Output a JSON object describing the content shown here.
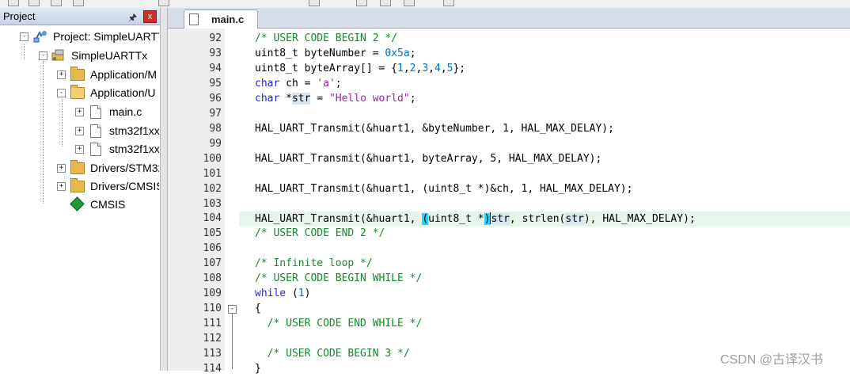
{
  "project_panel": {
    "title": "Project",
    "pin_glyph": "➕",
    "close_glyph": "x",
    "tree": [
      {
        "label": "Project: SimpleUARTT",
        "icon": "project-icon",
        "expander": "-"
      },
      {
        "label": "SimpleUARTTx",
        "icon": "target-icon",
        "expander": "-"
      },
      {
        "label": "Application/M",
        "icon": "folder-icon",
        "expander": "+"
      },
      {
        "label": "Application/U",
        "icon": "folder-open-icon",
        "expander": "-"
      },
      {
        "label": "main.c",
        "icon": "file-icon",
        "expander": "+"
      },
      {
        "label": "stm32f1xx",
        "icon": "file-icon",
        "expander": "+"
      },
      {
        "label": "stm32f1xx",
        "icon": "file-icon",
        "expander": "+"
      },
      {
        "label": "Drivers/STM32",
        "icon": "folder-icon",
        "expander": "+"
      },
      {
        "label": "Drivers/CMSIS",
        "icon": "folder-icon",
        "expander": "+"
      },
      {
        "label": "CMSIS",
        "icon": "cmsis-diamond-icon",
        "expander": ""
      }
    ]
  },
  "editor": {
    "tab_label": "main.c",
    "lines": [
      {
        "n": "92"
      },
      {
        "n": "93"
      },
      {
        "n": "94"
      },
      {
        "n": "95"
      },
      {
        "n": "96"
      },
      {
        "n": "97"
      },
      {
        "n": "98"
      },
      {
        "n": "99"
      },
      {
        "n": "100"
      },
      {
        "n": "101"
      },
      {
        "n": "102"
      },
      {
        "n": "103"
      },
      {
        "n": "104"
      },
      {
        "n": "105"
      },
      {
        "n": "106"
      },
      {
        "n": "107"
      },
      {
        "n": "108"
      },
      {
        "n": "109"
      },
      {
        "n": "110"
      },
      {
        "n": "111"
      },
      {
        "n": "112"
      },
      {
        "n": "113"
      },
      {
        "n": "114"
      }
    ],
    "code": {
      "l92": "/* USER CODE BEGIN 2 */",
      "l93a": "uint8_t byteNumber = ",
      "l93b": "0x5a",
      "l93c": ";",
      "l94a": "uint8_t byteArray[] = {",
      "l94b": "1",
      "l94c": ",",
      "l94d": "2",
      "l94e": ",",
      "l94f": "3",
      "l94g": ",",
      "l94h": "4",
      "l94i": ",",
      "l94j": "5",
      "l94k": "};",
      "l95a": "char",
      "l95b": " ch = ",
      "l95c": "'a'",
      "l95d": ";",
      "l96a": "char",
      "l96b": " *",
      "l96c": "str",
      "l96d": " = ",
      "l96e": "\"Hello world\"",
      "l96f": ";",
      "l98": "HAL_UART_Transmit(&huart1, &byteNumber, 1, HAL_MAX_DELAY);",
      "l100": "HAL_UART_Transmit(&huart1, byteArray, 5, HAL_MAX_DELAY);",
      "l102": "HAL_UART_Transmit(&huart1, (uint8_t *)&ch, 1, HAL_MAX_DELAY);",
      "l104a": "HAL_UART_Transmit(&huart1, ",
      "l104b": "(",
      "l104c": "uint8_t *",
      "l104d": ")",
      "l104e": "str",
      "l104f": ", strlen(",
      "l104g": "str",
      "l104h": "), HAL_MAX_DELAY);",
      "l105": "/* USER CODE END 2 */",
      "l107": "/* Infinite loop */",
      "l108": "/* USER CODE BEGIN WHILE */",
      "l109a": "while",
      "l109b": " (",
      "l109c": "1",
      "l109d": ")",
      "l110": "{",
      "l111": "  /* USER CODE END WHILE */",
      "l113": "  /* USER CODE BEGIN 3 */",
      "l114": "}"
    },
    "fold_glyph": "-"
  },
  "watermark": "CSDN @古译汉书",
  "colors": {
    "comment": "#118a2a",
    "keyword": "#2020ff",
    "string": "#a020a0",
    "number": "#0070c0",
    "current_line": "#e6f7ea",
    "brace_match": "#28d0ff"
  }
}
